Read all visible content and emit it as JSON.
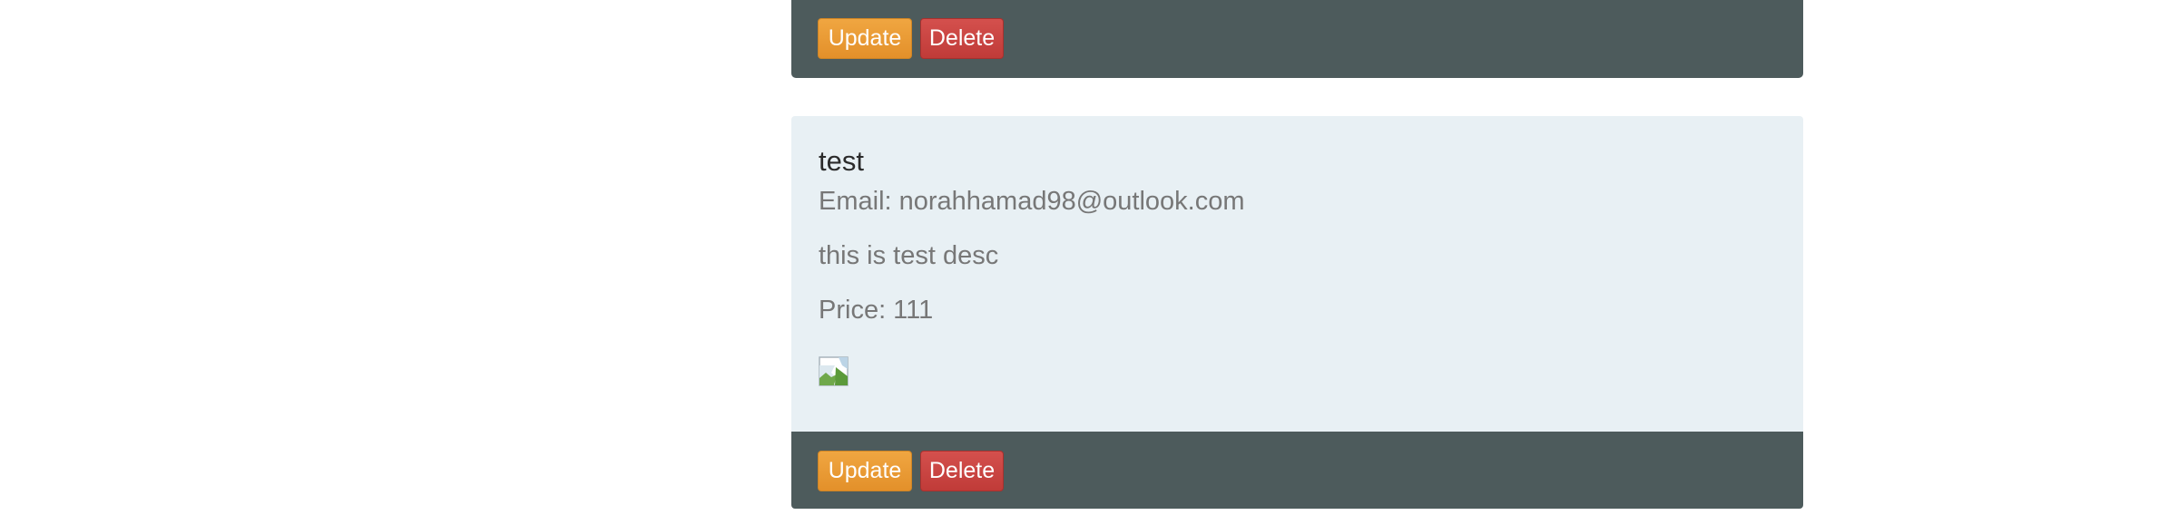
{
  "cards": [
    {
      "footer": {
        "update_label": "Update",
        "delete_label": "Delete"
      }
    },
    {
      "title": "test",
      "email": "Email: norahhamad98@outlook.com",
      "description": "this is test desc",
      "price": "Price: 111",
      "image_icon": "broken-image-icon",
      "footer": {
        "update_label": "Update",
        "delete_label": "Delete"
      }
    }
  ],
  "colors": {
    "footer_bg": "#4d5b5c",
    "card_body_bg": "#e8f0f4",
    "update_button": "#e99b36",
    "delete_button": "#c9443f"
  }
}
